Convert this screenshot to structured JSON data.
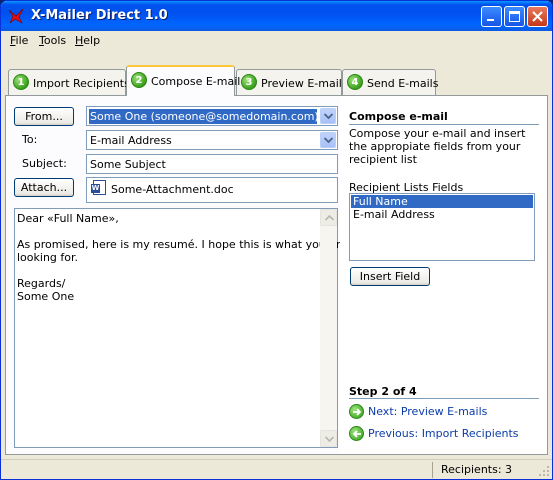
{
  "window": {
    "title": "X-Mailer Direct 1.0"
  },
  "menu": [
    {
      "label": "File",
      "accel": "F",
      "rest": "ile"
    },
    {
      "label": "Tools",
      "accel": "T",
      "rest": "ools"
    },
    {
      "label": "Help",
      "accel": "H",
      "rest": "elp"
    }
  ],
  "tabs": [
    {
      "num": "1",
      "label": "Import Recipients"
    },
    {
      "num": "2",
      "label": "Compose E-mail"
    },
    {
      "num": "3",
      "label": "Preview E-mails"
    },
    {
      "num": "4",
      "label": "Send E-mails"
    }
  ],
  "compose": {
    "from_button": "From...",
    "from_value": "Some One (someone@somedomain.com)",
    "to_label": "To:",
    "to_value": "E-mail Address",
    "subject_label": "Subject:",
    "subject_value": "Some Subject",
    "attach_button": "Attach...",
    "attachment_name": "Some-Attachment.doc",
    "body_lines": [
      "Dear «Full Name»,",
      "",
      "As promised, here is my resumé. I hope this is what you are",
      "looking for.",
      "",
      "Regards/",
      "Some One"
    ]
  },
  "side": {
    "title": "Compose e-mail",
    "description": "Compose your e-mail and insert the appropiate fields from your recipient list",
    "fields_label": "Recipient Lists Fields",
    "fields": [
      "Full Name",
      "E-mail Address"
    ],
    "insert_button": "Insert Field",
    "step": "Step 2 of 4",
    "next_link": "Next: Preview E-mails",
    "prev_link": "Previous: Import Recipients"
  },
  "status": {
    "recipients": "Recipients: 3"
  },
  "colors": {
    "selection": "#316ac5",
    "link": "#0b3ca8",
    "titlebar": "#0053ee"
  }
}
